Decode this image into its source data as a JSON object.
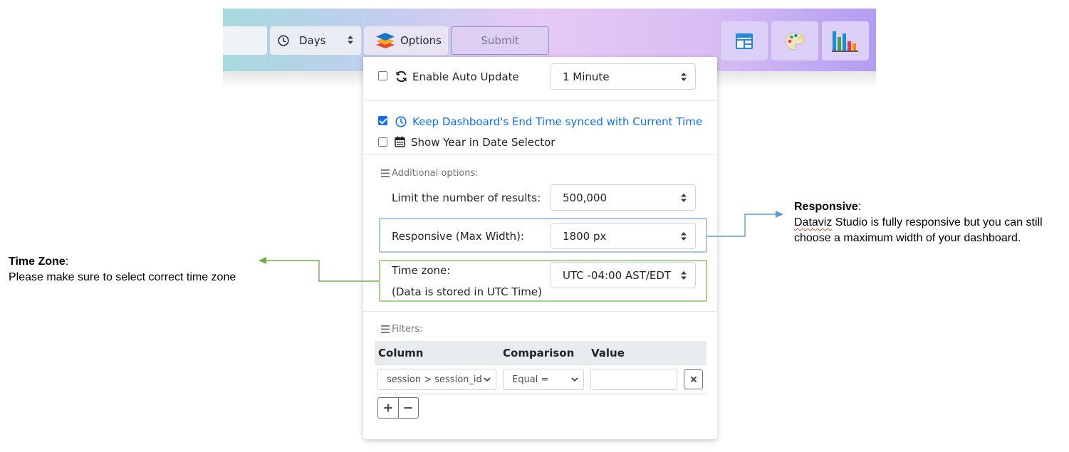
{
  "toolbar": {
    "range_unit": "Days",
    "options_label": "Options",
    "submit_label": "Submit",
    "icons": [
      "layout-icon",
      "palette-icon",
      "bar-chart-icon"
    ]
  },
  "panel": {
    "auto_update": {
      "label": "Enable Auto Update",
      "checked": false,
      "interval": "1 Minute"
    },
    "sync_end_time": {
      "label": "Keep Dashboard's End Time synced with Current Time",
      "checked": true
    },
    "show_year": {
      "label": "Show Year in Date Selector",
      "checked": false
    },
    "additional_heading": "Additional options:",
    "limit": {
      "label": "Limit the number of results:",
      "value": "500,000"
    },
    "responsive": {
      "label": "Responsive (Max Width):",
      "value": "1800 px"
    },
    "timezone": {
      "label": "Time zone:",
      "note": "(Data is stored in UTC Time)",
      "value": "UTC -04:00 AST/EDT"
    },
    "filters_heading": "Filters:",
    "filters_table": {
      "headers": [
        "Column",
        "Comparison",
        "Value"
      ],
      "row": {
        "column": "session > session_id",
        "comparison": "Equal =",
        "value": ""
      }
    }
  },
  "annotations": {
    "responsive": {
      "title": "Responsive",
      "title_suffix": ":",
      "line1_word": "Dataviz",
      "line1_rest": " Studio is fully responsive but you can still",
      "line2": "choose a maximum width of your dashboard."
    },
    "timezone": {
      "title": "Time Zone",
      "title_suffix": ":",
      "text": "Please make sure to select correct time zone"
    }
  },
  "colors": {
    "primary": "#0d6efd",
    "responsive_box": "#a9c4e4",
    "timezone_box": "#a9d18e",
    "responsive_arrow": "#5b9bd5",
    "timezone_arrow": "#70ad47"
  }
}
